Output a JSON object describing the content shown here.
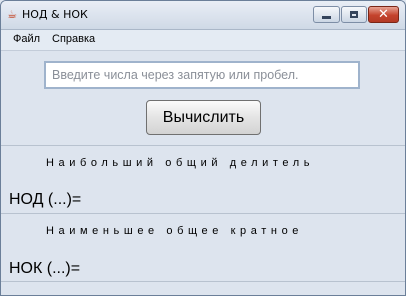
{
  "window": {
    "title": "НОД & НОК",
    "app_icon": "java-cup-icon",
    "close_color": "#c4432d"
  },
  "menu": {
    "file_label": "Файл",
    "help_label": "Справка"
  },
  "input": {
    "placeholder": "Введите числа через запятую или пробел.",
    "value": ""
  },
  "calculate_button": {
    "label": "Вычислить"
  },
  "gcd": {
    "caption": "Наибольший общий делитель",
    "result": "НОД  (...)="
  },
  "lcm": {
    "caption": "Наименьшее общее кратное",
    "result": "НОК (...)="
  }
}
